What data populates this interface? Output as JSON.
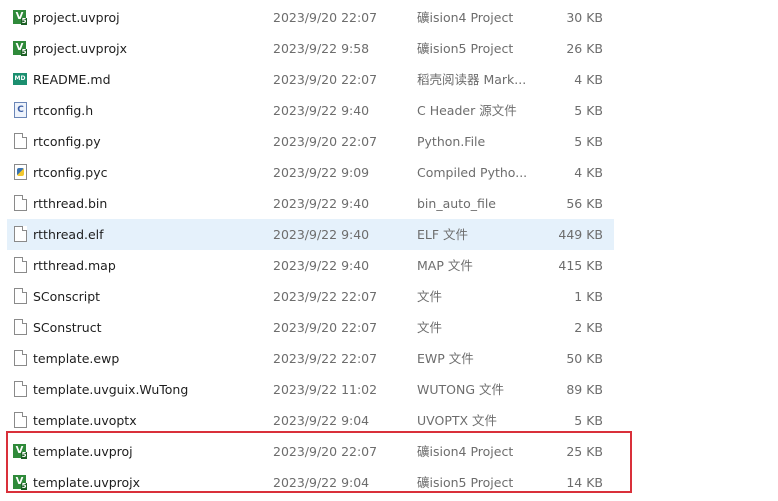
{
  "files": [
    {
      "name": "project.uvproj",
      "date": "2023/9/20 22:07",
      "type": "礦ision4 Project",
      "size": "30 KB",
      "icon": "keil-icon"
    },
    {
      "name": "project.uvprojx",
      "date": "2023/9/22 9:58",
      "type": "礦ision5 Project",
      "size": "26 KB",
      "icon": "keil-icon"
    },
    {
      "name": "README.md",
      "date": "2023/9/20 22:07",
      "type": "稻壳阅读器 Mark...",
      "size": "4 KB",
      "icon": "markdown-icon"
    },
    {
      "name": "rtconfig.h",
      "date": "2023/9/22 9:40",
      "type": "C Header 源文件",
      "size": "5 KB",
      "icon": "c-header-icon"
    },
    {
      "name": "rtconfig.py",
      "date": "2023/9/20 22:07",
      "type": "Python.File",
      "size": "5 KB",
      "icon": "file-icon"
    },
    {
      "name": "rtconfig.pyc",
      "date": "2023/9/22 9:09",
      "type": "Compiled Pytho...",
      "size": "4 KB",
      "icon": "python-icon"
    },
    {
      "name": "rtthread.bin",
      "date": "2023/9/22 9:40",
      "type": "bin_auto_file",
      "size": "56 KB",
      "icon": "file-icon"
    },
    {
      "name": "rtthread.elf",
      "date": "2023/9/22 9:40",
      "type": "ELF 文件",
      "size": "449 KB",
      "icon": "file-icon",
      "selected": true
    },
    {
      "name": "rtthread.map",
      "date": "2023/9/22 9:40",
      "type": "MAP 文件",
      "size": "415 KB",
      "icon": "file-icon"
    },
    {
      "name": "SConscript",
      "date": "2023/9/22 22:07",
      "type": "文件",
      "size": "1 KB",
      "icon": "file-icon"
    },
    {
      "name": "SConstruct",
      "date": "2023/9/20 22:07",
      "type": "文件",
      "size": "2 KB",
      "icon": "file-icon"
    },
    {
      "name": "template.ewp",
      "date": "2023/9/22 22:07",
      "type": "EWP 文件",
      "size": "50 KB",
      "icon": "file-icon"
    },
    {
      "name": "template.uvguix.WuTong",
      "date": "2023/9/22 11:02",
      "type": "WUTONG 文件",
      "size": "89 KB",
      "icon": "file-icon"
    },
    {
      "name": "template.uvoptx",
      "date": "2023/9/22 9:04",
      "type": "UVOPTX 文件",
      "size": "5 KB",
      "icon": "file-icon"
    },
    {
      "name": "template.uvproj",
      "date": "2023/9/20 22:07",
      "type": "礦ision4 Project",
      "size": "25 KB",
      "icon": "keil-icon"
    },
    {
      "name": "template.uvprojx",
      "date": "2023/9/22 9:04",
      "type": "礦ision5 Project",
      "size": "14 KB",
      "icon": "keil-icon"
    }
  ],
  "highlight_color": "#d9303a",
  "selection_color": "#e5f1fb"
}
